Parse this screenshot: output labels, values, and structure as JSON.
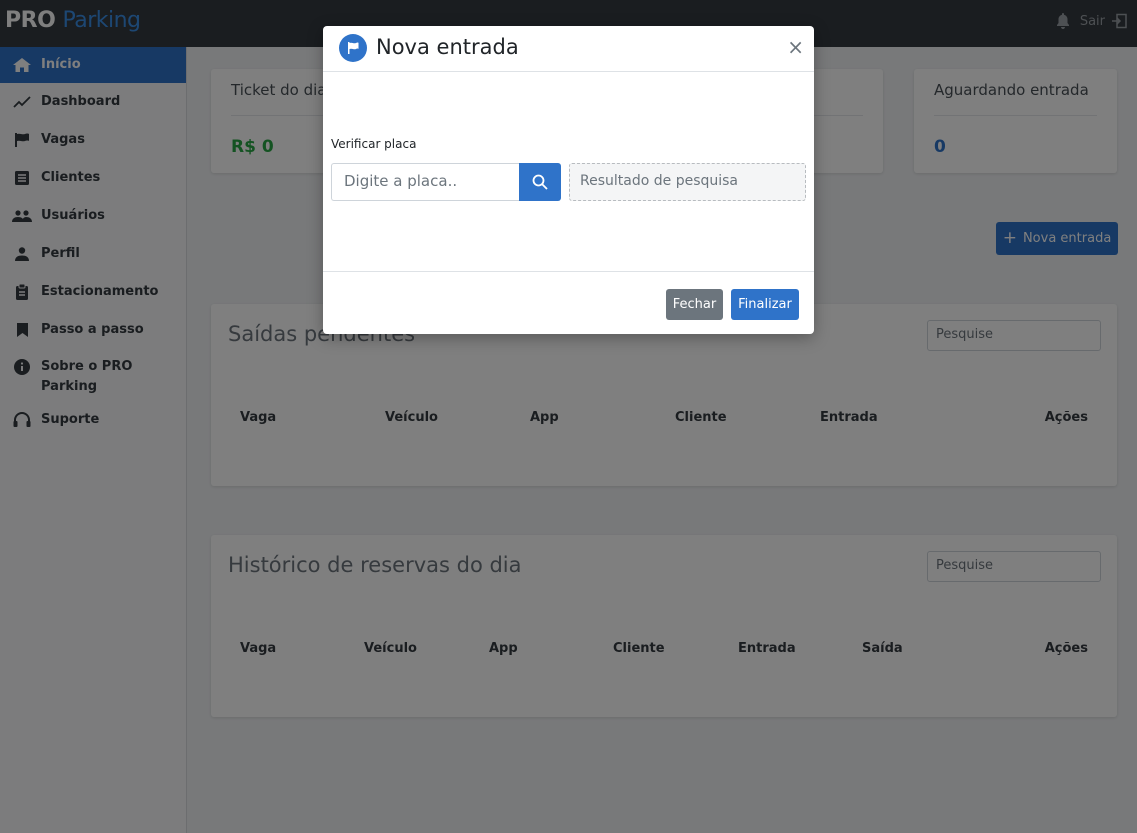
{
  "brand": {
    "part1": "PRO",
    "part2": "Parking"
  },
  "topbar": {
    "logout_label": "Sair"
  },
  "sidebar": {
    "items": [
      {
        "label": "Início",
        "icon": "home-icon"
      },
      {
        "label": "Dashboard",
        "icon": "chart-line-icon"
      },
      {
        "label": "Vagas",
        "icon": "flag-icon"
      },
      {
        "label": "Clientes",
        "icon": "list-icon"
      },
      {
        "label": "Usuários",
        "icon": "users-icon"
      },
      {
        "label": "Perfil",
        "icon": "user-icon"
      },
      {
        "label": "Estacionamento",
        "icon": "clipboard-icon"
      },
      {
        "label": "Passo a passo",
        "icon": "bookmark-icon"
      },
      {
        "label": "Sobre o PRO Parking",
        "icon": "info-icon"
      },
      {
        "label": "Suporte",
        "icon": "headset-icon"
      }
    ]
  },
  "stats": {
    "ticket": {
      "title": "Ticket do dia",
      "value": "R$ 0"
    },
    "waiting": {
      "title": "Aguardando entrada",
      "value": "0"
    }
  },
  "new_entry_button": "Nova entrada",
  "pending": {
    "title": "Saídas pendentes",
    "search_placeholder": "Pesquise",
    "columns": [
      "Vaga",
      "Veículo",
      "App",
      "Cliente",
      "Entrada",
      "Ações"
    ]
  },
  "history": {
    "title": "Histórico de reservas do dia",
    "search_placeholder": "Pesquise",
    "columns": [
      "Vaga",
      "Veículo",
      "App",
      "Cliente",
      "Entrada",
      "Saída",
      "Ações"
    ]
  },
  "modal": {
    "title": "Nova entrada",
    "close_symbol": "×",
    "verify_label": "Verificar placa",
    "plate_placeholder": "Digite a placa..",
    "result_placeholder": "Resultado de pesquisa",
    "close_button": "Fechar",
    "finish_button": "Finalizar"
  },
  "colors": {
    "primary": "#2f73c9",
    "topbar": "#343a40",
    "success": "#28a745",
    "secondary": "#6c757d"
  }
}
